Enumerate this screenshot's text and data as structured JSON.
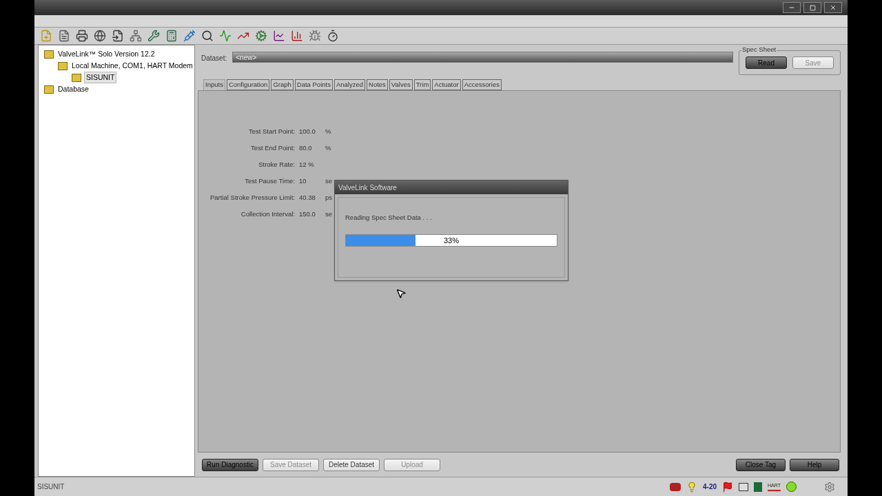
{
  "tree": [
    {
      "label": "ValveLink™ Solo Version 12.2",
      "selected": false,
      "children": [
        {
          "label": "Local Machine, COM1, HART Modem",
          "selected": false,
          "children": [
            {
              "label": "SISUNIT",
              "selected": true
            }
          ]
        }
      ]
    },
    {
      "label": "Database",
      "selected": false
    }
  ],
  "dataset": {
    "label": "Dataset:",
    "value": "<new>"
  },
  "spec_sheet": {
    "title": "Spec Sheet",
    "buttons": [
      {
        "label": "Read",
        "kind": "dark",
        "disabled": false
      },
      {
        "label": "Save",
        "kind": "light",
        "disabled": true
      }
    ]
  },
  "tabs": [
    {
      "label": "Inputs",
      "selected": true
    },
    {
      "label": "Configuration",
      "selected": false
    },
    {
      "label": "Graph",
      "selected": false
    },
    {
      "label": "Data Points",
      "selected": false
    },
    {
      "label": "Analyzed",
      "selected": false
    },
    {
      "label": "Notes",
      "selected": false
    },
    {
      "label": "Valves",
      "selected": false
    },
    {
      "label": "Trim",
      "selected": false
    },
    {
      "label": "Actuator",
      "selected": false
    },
    {
      "label": "Accessories",
      "selected": false
    }
  ],
  "inputs": [
    {
      "label": "Test Start Point:",
      "value": "100.0",
      "unit": "%"
    },
    {
      "label": "Test End Point:",
      "value": "80.0",
      "unit": "%"
    },
    {
      "label": "Stroke Rate:",
      "value": "12 %"
    },
    {
      "label": "Test Pause Time:",
      "value": "10",
      "unit": "se"
    },
    {
      "label": "Partial Stroke Pressure Limit:",
      "value": "40.38",
      "unit": "ps"
    },
    {
      "label": "Collection Interval:",
      "value": "150.0",
      "unit": "se"
    }
  ],
  "dialog": {
    "title": "ValveLink Software",
    "message": "Reading Spec Sheet Data . . .",
    "progress": {
      "level": 0.33,
      "reading": "33%"
    }
  },
  "bottom_buttons": [
    {
      "label": "Run Diagnostic",
      "kind": "dark",
      "disabled": false
    },
    {
      "label": "Save Dataset",
      "kind": "light",
      "disabled": true
    },
    {
      "label": "Delete Dataset",
      "kind": "light",
      "disabled": false
    },
    {
      "label": "Upload",
      "kind": "light",
      "disabled": true
    }
  ],
  "right_buttons": [
    {
      "label": "Close Tag",
      "kind": "dark",
      "disabled": false
    },
    {
      "label": "Help",
      "kind": "dark",
      "disabled": false
    }
  ],
  "status_bar": {
    "text": "SISUNIT",
    "loop_label": "4-20",
    "hart_label": "HART"
  }
}
